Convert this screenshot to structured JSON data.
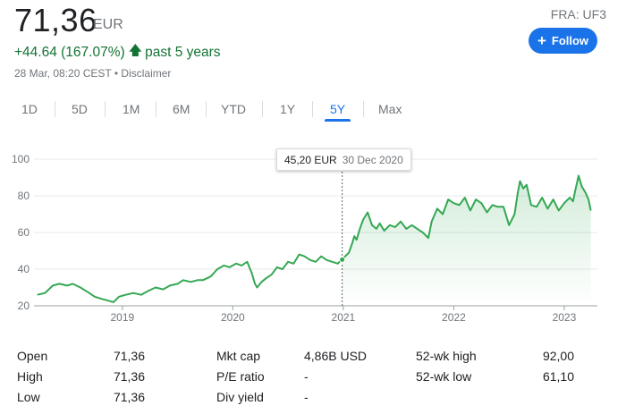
{
  "quote": {
    "price": "71,36",
    "currency": "EUR",
    "exchange": "FRA: UF3",
    "change": "+44.64 (167.07%)",
    "change_arrow": "arrow-up-icon",
    "period": "past 5 years",
    "timestamp": "28 Mar, 08:20 CEST",
    "separator": "•",
    "disclaimer": "Disclaimer",
    "follow_label": "Follow"
  },
  "ranges": [
    {
      "label": "1D",
      "active": false
    },
    {
      "label": "5D",
      "active": false
    },
    {
      "label": "1M",
      "active": false
    },
    {
      "label": "6M",
      "active": false
    },
    {
      "label": "YTD",
      "active": false
    },
    {
      "label": "1Y",
      "active": false
    },
    {
      "label": "5Y",
      "active": true
    },
    {
      "label": "Max",
      "active": false
    }
  ],
  "colors": {
    "line": "#34a853",
    "positive": "#137333",
    "accent": "#1a73e8",
    "grid": "#e8eaed",
    "axis_text": "#70757a"
  },
  "tooltip": {
    "value": "45,20 EUR",
    "date": "30 Dec 2020"
  },
  "chart_data": {
    "type": "line",
    "x_ticks": [
      "2019",
      "2020",
      "2021",
      "2022",
      "2023"
    ],
    "y_ticks": [
      "20",
      "40",
      "60",
      "80",
      "100"
    ],
    "ylim": [
      20,
      100
    ],
    "xlim": [
      2018.2,
      2023.3
    ],
    "grid": true,
    "hover": {
      "x": 2020.99,
      "y": 45.2
    },
    "series": [
      {
        "x": [
          2018.23,
          2018.3,
          2018.37,
          2018.43,
          2018.5,
          2018.55,
          2018.62,
          2018.7,
          2018.75,
          2018.8,
          2018.86,
          2018.92,
          2018.97,
          2019.03,
          2019.1,
          2019.17,
          2019.23,
          2019.3,
          2019.37,
          2019.43,
          2019.5,
          2019.55,
          2019.62,
          2019.68,
          2019.73,
          2019.8,
          2019.86,
          2019.92,
          2019.97,
          2020.03,
          2020.08,
          2020.13,
          2020.17,
          2020.2,
          2020.22,
          2020.26,
          2020.3,
          2020.35,
          2020.4,
          2020.45,
          2020.5,
          2020.55,
          2020.6,
          2020.65,
          2020.7,
          2020.75,
          2020.8,
          2020.85,
          2020.9,
          2020.95,
          2021.0,
          2021.05,
          2021.08,
          2021.1,
          2021.12,
          2021.15,
          2021.18,
          2021.22,
          2021.26,
          2021.3,
          2021.33,
          2021.37,
          2021.42,
          2021.47,
          2021.52,
          2021.57,
          2021.62,
          2021.67,
          2021.72,
          2021.77,
          2021.8,
          2021.85,
          2021.9,
          2021.95,
          2022.0,
          2022.05,
          2022.1,
          2022.15,
          2022.2,
          2022.25,
          2022.3,
          2022.35,
          2022.4,
          2022.45,
          2022.5,
          2022.55,
          2022.58,
          2022.6,
          2022.63,
          2022.66,
          2022.7,
          2022.75,
          2022.8,
          2022.85,
          2022.9,
          2022.95,
          2023.0,
          2023.05,
          2023.08,
          2023.1,
          2023.13,
          2023.16,
          2023.19,
          2023.22,
          2023.24
        ],
        "y": [
          26,
          27,
          31,
          32,
          31,
          32,
          30,
          27,
          25,
          24,
          23,
          22,
          25,
          26,
          27,
          26,
          28,
          30,
          29,
          31,
          32,
          34,
          33,
          34,
          34,
          36,
          40,
          42,
          41,
          43,
          42,
          44,
          38,
          32,
          30,
          33,
          35,
          37,
          41,
          40,
          44,
          43,
          48,
          47,
          45,
          44,
          47,
          45,
          44,
          43,
          46,
          49,
          54,
          58,
          56,
          62,
          67,
          71,
          64,
          62,
          65,
          61,
          64,
          63,
          66,
          62,
          64,
          62,
          60,
          57,
          66,
          73,
          70,
          78,
          76,
          75,
          79,
          72,
          78,
          76,
          71,
          75,
          74,
          74,
          64,
          70,
          82,
          88,
          84,
          86,
          75,
          74,
          79,
          73,
          78,
          72,
          76,
          79,
          77,
          83,
          91,
          85,
          82,
          78,
          72
        ]
      }
    ]
  },
  "stats": {
    "col1": [
      {
        "label": "Open",
        "value": "71,36"
      },
      {
        "label": "High",
        "value": "71,36"
      },
      {
        "label": "Low",
        "value": "71,36"
      }
    ],
    "col2": [
      {
        "label": "Mkt cap",
        "value": "4,86B USD"
      },
      {
        "label": "P/E ratio",
        "value": "-"
      },
      {
        "label": "Div yield",
        "value": "-"
      }
    ],
    "col3": [
      {
        "label": "52-wk high",
        "value": "92,00"
      },
      {
        "label": "52-wk low",
        "value": "61,10"
      }
    ]
  }
}
